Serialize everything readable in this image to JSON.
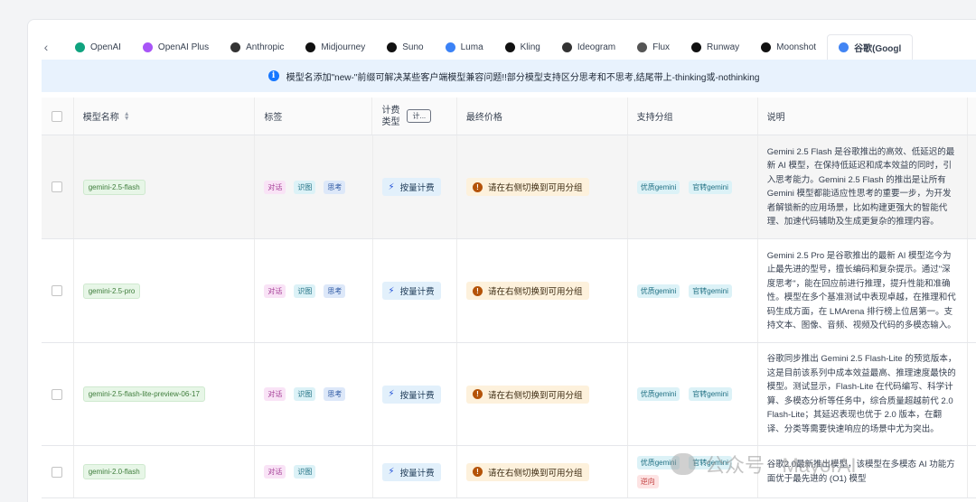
{
  "tabs": [
    {
      "label": "OpenAI",
      "icon": "openai-icon",
      "color": "#10a37f"
    },
    {
      "label": "OpenAI Plus",
      "icon": "openai-plus-icon",
      "color": "#a855f7"
    },
    {
      "label": "Anthropic",
      "icon": "anthropic-icon",
      "color": "#333333"
    },
    {
      "label": "Midjourney",
      "icon": "midjourney-icon",
      "color": "#111111"
    },
    {
      "label": "Suno",
      "icon": "suno-icon",
      "color": "#111111"
    },
    {
      "label": "Luma",
      "icon": "luma-icon",
      "color": "#3b82f6"
    },
    {
      "label": "Kling",
      "icon": "kling-icon",
      "color": "#111111"
    },
    {
      "label": "Ideogram",
      "icon": "ideogram-icon",
      "color": "#333333"
    },
    {
      "label": "Flux",
      "icon": "flux-icon",
      "color": "#555555"
    },
    {
      "label": "Runway",
      "icon": "runway-icon",
      "color": "#111111"
    },
    {
      "label": "Moonshot",
      "icon": "moonshot-icon",
      "color": "#111111"
    },
    {
      "label": "谷歌(Googl",
      "icon": "google-icon",
      "color": "#4285f4"
    }
  ],
  "notice": "模型名添加\"new-\"前缀可解决某些客户端模型兼容问题!!部分模型支持区分思考和不思考,结尾带上-thinking或-nothinking",
  "columns": {
    "name": "模型名称",
    "tags": "标签",
    "billing_type_line1": "计费",
    "billing_type_line2": "类型",
    "billing_filter": "计...",
    "price": "最终价格",
    "groups": "支持分组",
    "description": "说明"
  },
  "rows": [
    {
      "model": "gemini-2.5-flash",
      "tags": [
        "对话",
        "识图",
        "思考"
      ],
      "billing": "按量计费",
      "price": "请在右侧切换到可用分组",
      "groups": [
        "优质gemini",
        "官转gemini"
      ],
      "description": "Gemini 2.5 Flash 是谷歌推出的高效、低延迟的最新 AI 模型，在保持低延迟和成本效益的同时，引入思考能力。Gemini 2.5 Flash 的推出是让所有 Gemini 模型都能适应性思考的重要一步，为开发者解锁新的应用场景，比如构建更强大的智能代理、加速代码辅助及生成更复杂的推理内容。"
    },
    {
      "model": "gemini-2.5-pro",
      "tags": [
        "对话",
        "识图",
        "思考"
      ],
      "billing": "按量计费",
      "price": "请在右侧切换到可用分组",
      "groups": [
        "优质gemini",
        "官转gemini"
      ],
      "description": "Gemini 2.5 Pro 是谷歌推出的最新 AI 模型迄今为止最先进的型号，擅长编码和复杂提示。通过\"深度思考\"，能在回应前进行推理，提升性能和准确性。模型在多个基准测试中表现卓越，在推理和代码生成方面，在 LMArena 排行榜上位居第一。支持文本、图像、音频、视频及代码的多模态输入。"
    },
    {
      "model": "gemini-2.5-flash-lite-preview-06-17",
      "tags": [
        "对话",
        "识图",
        "思考"
      ],
      "billing": "按量计费",
      "price": "请在右侧切换到可用分组",
      "groups": [
        "优质gemini",
        "官转gemini"
      ],
      "description": "谷歌同步推出 Gemini 2.5 Flash-Lite 的预览版本，这是目前该系列中成本效益最高、推理速度最快的模型。测试显示，Flash-Lite 在代码编写、科学计算、多模态分析等任务中，综合质量超越前代 2.0 Flash-Lite；其延迟表现也优于 2.0 版本，在翻译、分类等需要快速响应的场景中尤为突出。"
    },
    {
      "model": "gemini-2.0-flash",
      "tags": [
        "对话",
        "识图"
      ],
      "billing": "按量计费",
      "price": "请在右侧切换到可用分组",
      "groups": [
        "优质gemini",
        "官转gemini",
        "逆向"
      ],
      "description": "谷歌2.0最新推出模型，该模型在多模态 AI 功能方面优于最先进的 (O1) 模型"
    }
  ],
  "watermark": "公众号 · MayorAI"
}
